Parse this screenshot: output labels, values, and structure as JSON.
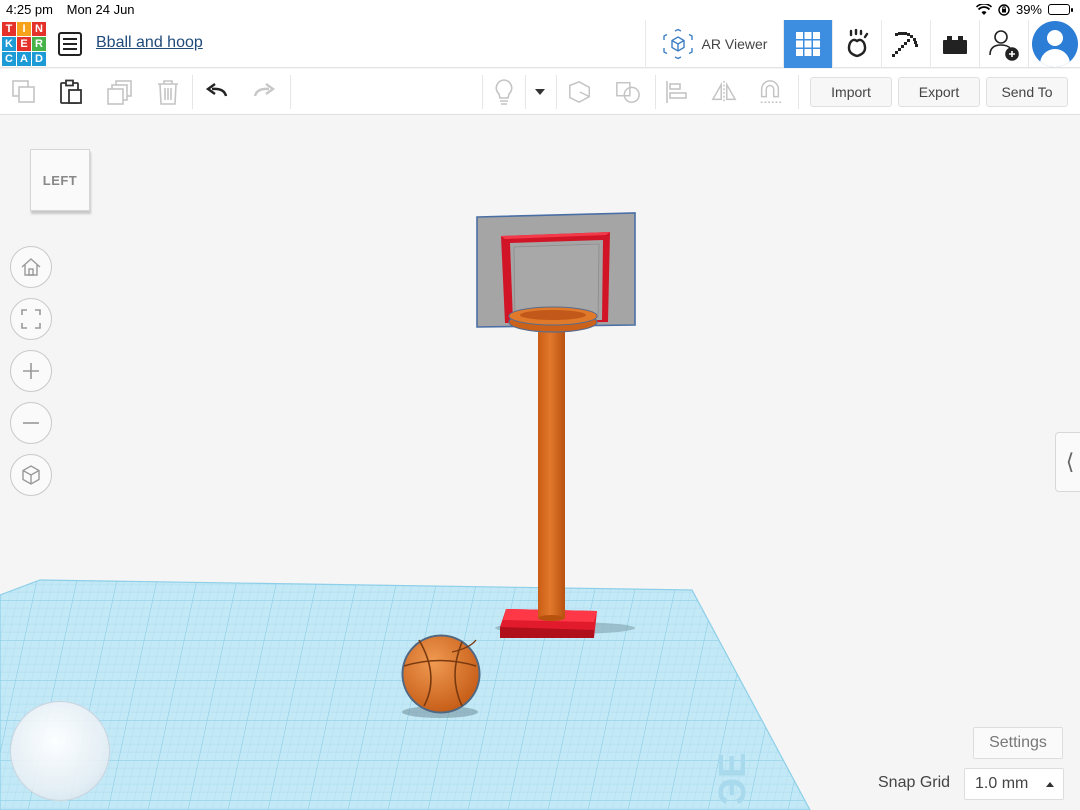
{
  "status_bar": {
    "time": "4:25 pm",
    "date": "Mon 24 Jun",
    "battery": "39%"
  },
  "logo": {
    "letters": [
      "T",
      "I",
      "N",
      "K",
      "E",
      "R",
      "C",
      "A",
      "D"
    ]
  },
  "header": {
    "design_title": "Bball and hoop",
    "ar_viewer_label": "AR Viewer"
  },
  "toolbar": {
    "import_label": "Import",
    "export_label": "Export",
    "send_to_label": "Send To"
  },
  "viewport": {
    "viewcube_face": "LEFT",
    "workplane_label": "ЭЕ",
    "settings_label": "Settings",
    "snap_grid_label": "Snap Grid",
    "snap_grid_value": "1.0 mm"
  },
  "colors": {
    "accent": "#3d8de0",
    "workplane": "#bfe6f5",
    "grid_line": "#8fd0ea",
    "hoop_orange": "#d86a1c",
    "base_red": "#e0182a",
    "backboard_grey": "#a3a3a3"
  }
}
